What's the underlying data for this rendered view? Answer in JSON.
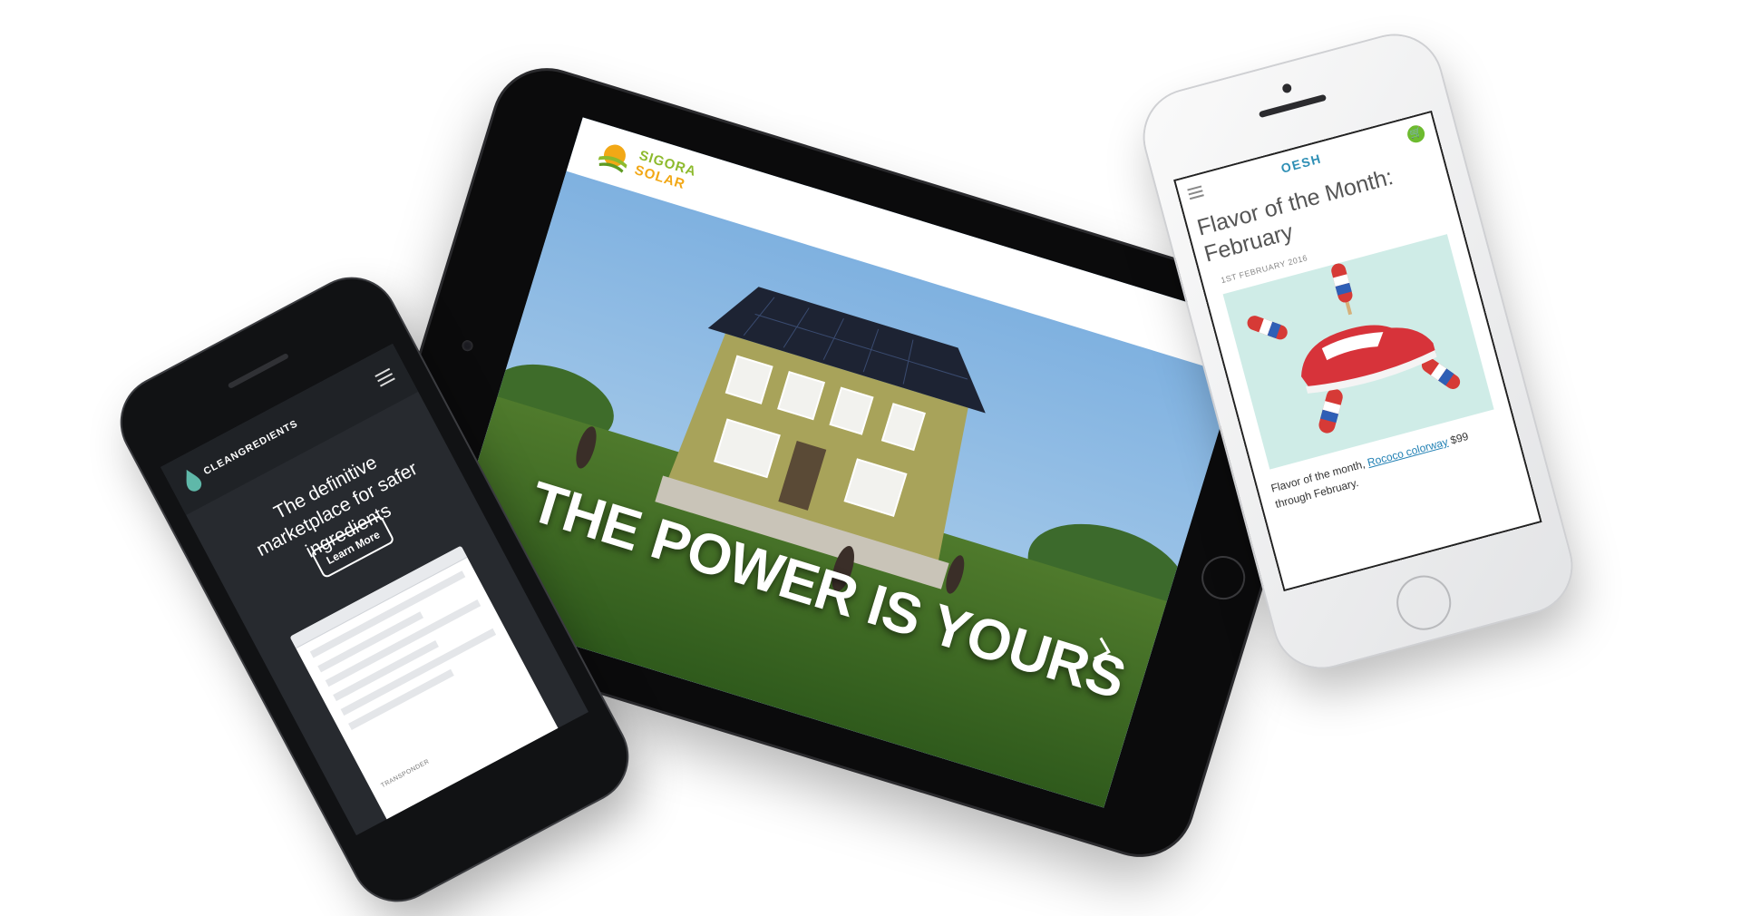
{
  "tablet": {
    "logo_line1": "SIGORA",
    "logo_line2": "SOLAR",
    "hero_headline": "THE POWER IS YOURS",
    "next_icon": "chevron-right-icon"
  },
  "phone_right": {
    "brand": "OESH",
    "menu_icon": "hamburger-menu-icon",
    "cart_icon": "cart-icon",
    "post": {
      "title": "Flavor of the Month: February",
      "date": "1ST FEBRUARY 2016",
      "body_prefix": "Flavor of the month, ",
      "link_text": "Rococo colorway",
      "body_suffix": " $99 through February."
    },
    "accent_color": "#6dbb2f",
    "brand_color": "#2e8fb5"
  },
  "phone_left": {
    "brand": "CLEANGREDIENTS",
    "menu_icon": "hamburger-menu-icon",
    "tagline": "The definitive marketplace for safer ingredients",
    "cta_label": "Learn More",
    "mock_label": "TRANSPONDER"
  },
  "colors": {
    "sigora_green": "#8dba2d",
    "sigora_orange": "#f2a816",
    "cleangredients_bg": "#272a2f"
  }
}
